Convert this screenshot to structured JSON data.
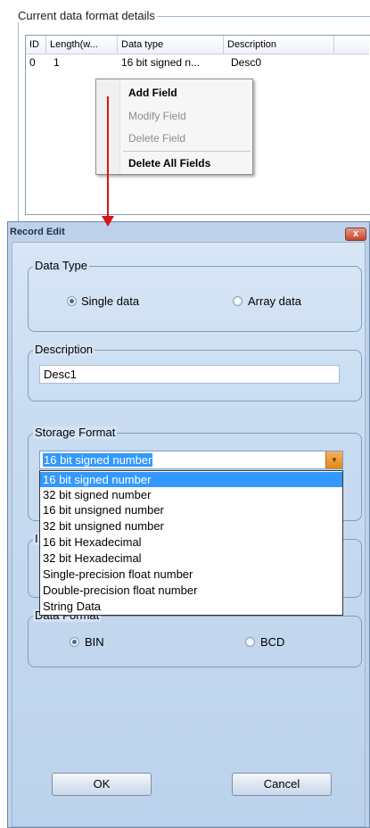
{
  "details_panel": {
    "group_title": "Current data format details",
    "columns": [
      "ID",
      "Length(w...",
      "Data type",
      "Description"
    ],
    "rows": [
      {
        "id": "0",
        "length": "1",
        "data_type": "16 bit signed n...",
        "description": "Desc0"
      }
    ]
  },
  "context_menu": {
    "items": [
      {
        "label": "Add Field",
        "enabled": true
      },
      {
        "label": "Modify Field",
        "enabled": false
      },
      {
        "label": "Delete Field",
        "enabled": false
      },
      {
        "label": "Delete All Fields",
        "enabled": true
      }
    ]
  },
  "dialog": {
    "title": "Record Edit",
    "close_label": "x",
    "data_type": {
      "legend": "Data Type",
      "options": [
        {
          "label": "Single data",
          "checked": true
        },
        {
          "label": "Array data",
          "checked": false
        }
      ]
    },
    "description": {
      "legend": "Description",
      "value": "Desc1"
    },
    "storage_format": {
      "legend": "Storage Format",
      "selected": "16 bit signed number",
      "options": [
        "16 bit signed number",
        "32 bit signed number",
        "16 bit unsigned number",
        "32 bit unsigned number",
        "16 bit Hexadecimal",
        "32 bit Hexadecimal",
        "Single-precision float number",
        "Double-precision float number",
        "String Data"
      ]
    },
    "partially_hidden_legend": "I",
    "data_format": {
      "legend": "Data Format",
      "options": [
        {
          "label": "BIN",
          "checked": true
        },
        {
          "label": "BCD",
          "checked": false
        }
      ]
    },
    "ok_label": "OK",
    "cancel_label": "Cancel"
  },
  "colors": {
    "arrow": "#d9141a",
    "selection": "#3399ff",
    "dialog_bg": "#c9dcf1",
    "close_button": "#c5432c"
  }
}
